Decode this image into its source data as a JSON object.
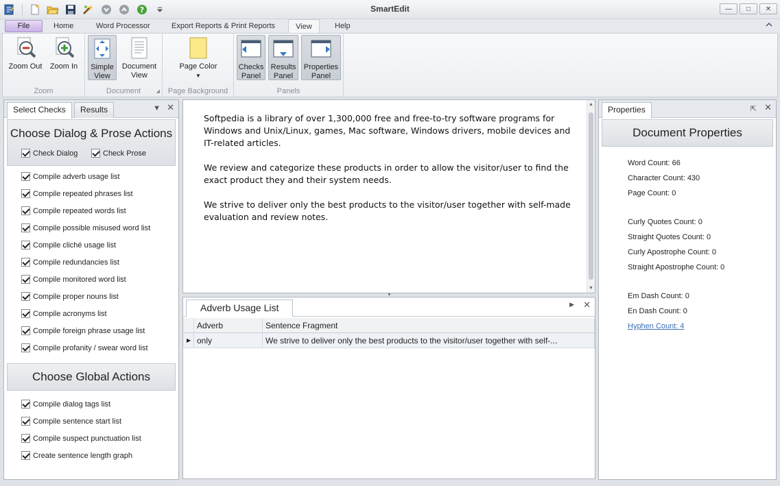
{
  "app": {
    "title": "SmartEdit",
    "window_controls": {
      "minimize": "—",
      "maximize": "□",
      "close": "✕"
    }
  },
  "quick_access": [
    "app-icon",
    "new-icon",
    "open-icon",
    "save-icon",
    "wizard-icon",
    "down-icon",
    "up-icon",
    "help-icon",
    "customize-icon"
  ],
  "ribbon_tabs": [
    "File",
    "Home",
    "Word Processor",
    "Export Reports & Print Reports",
    "View",
    "Help"
  ],
  "active_tab": "View",
  "ribbon": {
    "zoom": {
      "label": "Zoom",
      "zoom_out": "Zoom Out",
      "zoom_in": "Zoom In"
    },
    "document": {
      "label": "Document",
      "simple_view_1": "Simple",
      "simple_view_2": "View",
      "document_view_1": "Document",
      "document_view_2": "View"
    },
    "page_background": {
      "label": "Page Background",
      "page_color": "Page Color"
    },
    "panels": {
      "label": "Panels",
      "checks_1": "Checks",
      "checks_2": "Panel",
      "results_1": "Results",
      "results_2": "Panel",
      "properties_1": "Properties",
      "properties_2": "Panel"
    }
  },
  "left_panel": {
    "tabs": [
      "Select Checks",
      "Results"
    ],
    "section1_title": "Choose Dialog & Prose Actions",
    "check_dialog": "Check Dialog",
    "check_prose": "Check Prose",
    "prose_checks": [
      "Compile adverb usage list",
      "Compile repeated phrases list",
      "Compile repeated words list",
      "Compile possible misused word list",
      "Compile cliché usage list",
      "Compile redundancies list",
      "Compile monitored word list",
      "Compile proper nouns list",
      "Compile acronyms list",
      "Compile foreign phrase usage list",
      "Compile profanity / swear word list"
    ],
    "section2_title": "Choose Global Actions",
    "global_checks": [
      "Compile dialog tags list",
      "Compile sentence start list",
      "Compile suspect punctuation list",
      "Create sentence length graph"
    ]
  },
  "editor": {
    "paragraphs": [
      "Softpedia is a library of over 1,300,000 free and free-to-try software programs for Windows and Unix/Linux, games, Mac software, Windows drivers, mobile devices and IT-related articles.",
      "We review and categorize these products in order to allow the visitor/user to find the exact product they and their system needs.",
      "We strive to deliver only the best products to the visitor/user together with self-made evaluation and review notes."
    ]
  },
  "results_panel": {
    "tab": "Adverb Usage List",
    "columns": [
      "Adverb",
      "Sentence Fragment"
    ],
    "rows": [
      {
        "adverb": "only",
        "fragment": "We strive to deliver only the best products to the visitor/user together with self-..."
      }
    ]
  },
  "properties_panel": {
    "tab": "Properties",
    "title": "Document Properties",
    "lines": [
      "Word Count: 66",
      "Character Count: 430",
      "Page Count: 0",
      "Curly Quotes Count: 0",
      "Straight Quotes Count: 0",
      "Curly Apostrophe Count: 0",
      "Straight Apostrophe Count: 0",
      "Em Dash Count: 0",
      "En Dash Count: 0"
    ],
    "link_line": "Hyphen Count: 4"
  }
}
